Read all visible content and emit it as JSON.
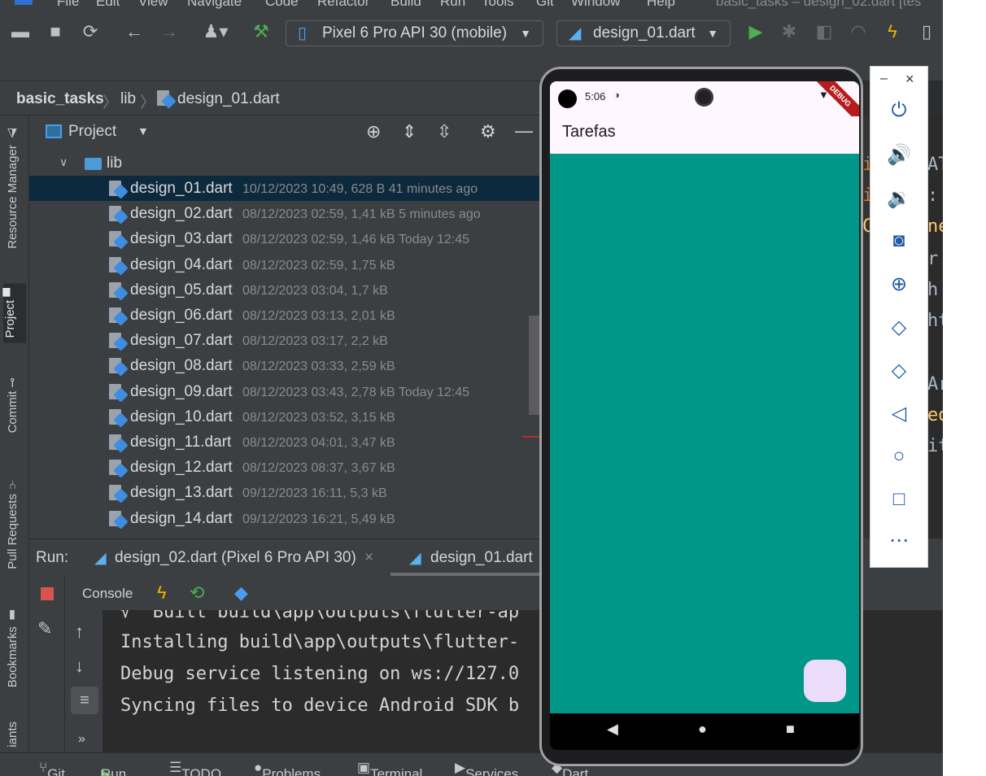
{
  "menu": {
    "items": [
      "File",
      "Edit",
      "View",
      "Navigate",
      "Code",
      "Refactor",
      "Build",
      "Run",
      "Tools",
      "Git",
      "Window",
      "Help"
    ],
    "window_title": "basic_tasks – design_02.dart [tes"
  },
  "toolbar": {
    "device_selector": "Pixel 6 Pro API 30 (mobile)",
    "run_config": "design_01.dart"
  },
  "breadcrumb": {
    "project": "basic_tasks",
    "folder": "lib",
    "file": "design_01.dart"
  },
  "project_panel": {
    "title": "Project",
    "folder": "lib",
    "files": [
      {
        "name": "design_01.dart",
        "meta": "10/12/2023 10:49, 628 B 41 minutes ago",
        "selected": true
      },
      {
        "name": "design_02.dart",
        "meta": "08/12/2023 02:59, 1,41 kB 5 minutes ago"
      },
      {
        "name": "design_03.dart",
        "meta": "08/12/2023 02:59, 1,46 kB Today 12:45"
      },
      {
        "name": "design_04.dart",
        "meta": "08/12/2023 02:59, 1,75 kB"
      },
      {
        "name": "design_05.dart",
        "meta": "08/12/2023 03:04, 1,7 kB"
      },
      {
        "name": "design_06.dart",
        "meta": "08/12/2023 03:13, 2,01 kB"
      },
      {
        "name": "design_07.dart",
        "meta": "08/12/2023 03:17, 2,2 kB"
      },
      {
        "name": "design_08.dart",
        "meta": "08/12/2023 03:33, 2,59 kB"
      },
      {
        "name": "design_09.dart",
        "meta": "08/12/2023 03:43, 2,78 kB Today 12:45"
      },
      {
        "name": "design_10.dart",
        "meta": "08/12/2023 03:52, 3,15 kB"
      },
      {
        "name": "design_11.dart",
        "meta": "08/12/2023 04:01, 3,47 kB"
      },
      {
        "name": "design_12.dart",
        "meta": "08/12/2023 08:37, 3,67 kB"
      },
      {
        "name": "design_13.dart",
        "meta": "09/12/2023 16:11, 5,3 kB"
      },
      {
        "name": "design_14.dart",
        "meta": "09/12/2023 16:21, 5,49 kB"
      }
    ]
  },
  "left_tabs": [
    "Resource Manager",
    "Project",
    "Commit",
    "Pull Requests",
    "Bookmarks",
    "iants"
  ],
  "run_panel": {
    "label": "Run:",
    "tab1": "design_02.dart (Pixel 6 Pro API 30)",
    "tab2": "design_01.dart",
    "console_label": "Console",
    "lines": [
      "√  Built build\\app\\outputs\\flutter-ap",
      "Installing build\\app\\outputs\\flutter-",
      "Debug service listening on ws://127.0",
      "Syncing files to device Android SDK b"
    ]
  },
  "editor_peek": [
    {
      "text": "i",
      "color": "#cc7832"
    },
    {
      "text": "AT",
      "color": "#a9b7c6"
    },
    {
      "text": "i",
      "color": "#cc7832"
    },
    {
      "text": ":",
      "color": "#a9b7c6"
    },
    {
      "text": "C",
      "color": "#ffc66d"
    },
    {
      "text": "ne",
      "color": "#ffc66d"
    },
    {
      "text": "r",
      "color": "#a9b7c6"
    },
    {
      "text": "h",
      "color": "#a9b7c6"
    },
    {
      "text": "ht",
      "color": "#a9b7c6"
    },
    {
      "text": "Ar",
      "color": "#a9b7c6"
    },
    {
      "text": "ed",
      "color": "#ffc66d"
    },
    {
      "text": "it",
      "color": "#a9b7c6"
    }
  ],
  "statusbar": {
    "git": "Git",
    "run": "Run",
    "todo": "TODO",
    "problems": "Problems",
    "terminal": "Terminal",
    "services": "Services",
    "dart": "Dart Analysis"
  },
  "phone": {
    "time": "5:06",
    "app_title": "Tarefas",
    "debug_banner": "DEBUG",
    "body_color": "#009688",
    "fab_color": "#ebdcfc"
  },
  "emulator_controls": {
    "minimize": "–",
    "close": "×"
  }
}
